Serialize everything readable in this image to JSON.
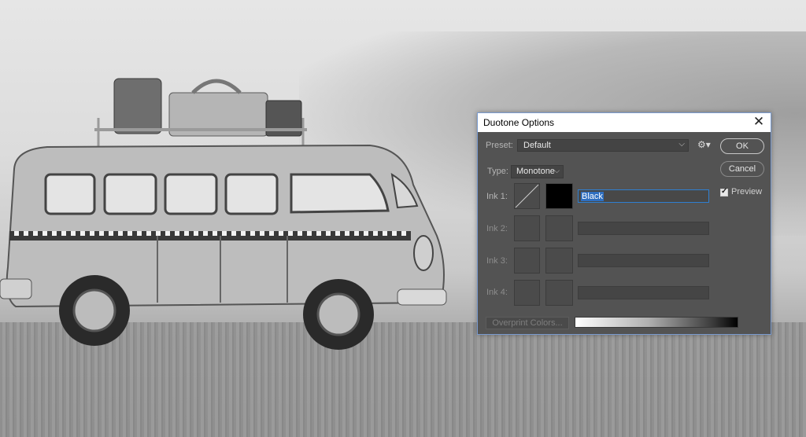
{
  "dialog": {
    "title": "Duotone Options",
    "preset_label": "Preset:",
    "preset_value": "Default",
    "type_label": "Type:",
    "type_value": "Monotone",
    "inks": [
      {
        "label": "Ink 1:",
        "name": "Black",
        "active": true
      },
      {
        "label": "Ink 2:",
        "name": "",
        "active": false
      },
      {
        "label": "Ink 3:",
        "name": "",
        "active": false
      },
      {
        "label": "Ink 4:",
        "name": "",
        "active": false
      }
    ],
    "overprint_label": "Overprint Colors...",
    "ok_label": "OK",
    "cancel_label": "Cancel",
    "preview_label": "Preview",
    "preview_checked": true
  },
  "icons": {
    "close": "close-icon",
    "gear": "gear-icon",
    "chevron": "chevron-down-icon",
    "checkmark": "checkmark-icon"
  },
  "colors": {
    "dialog_bg": "#535353",
    "focus_blue": "#2f7fd0",
    "ink1_color": "#000000"
  }
}
